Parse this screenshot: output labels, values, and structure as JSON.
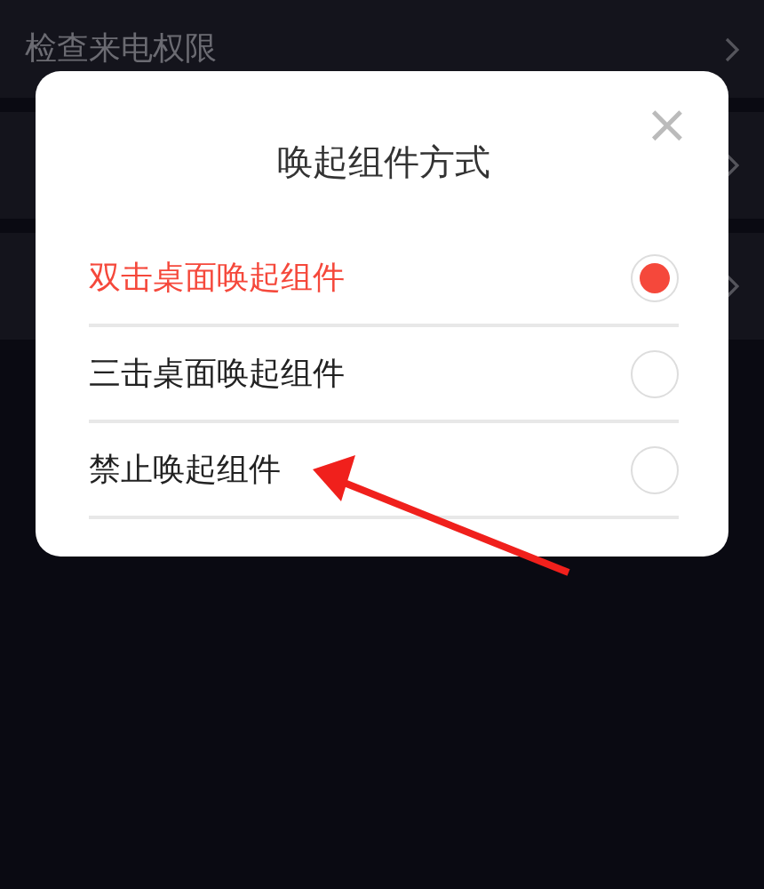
{
  "background_list": [
    {
      "kind": "labeled",
      "label": "检查来电权限"
    },
    {
      "kind": "covered"
    },
    {
      "kind": "covered"
    }
  ],
  "dialog": {
    "title": "唤起组件方式",
    "close": "×",
    "options": [
      {
        "label": "双击桌面唤起组件",
        "selected": true
      },
      {
        "label": "三击桌面唤起组件",
        "selected": false
      },
      {
        "label": "禁止唤起组件",
        "selected": false
      }
    ]
  }
}
